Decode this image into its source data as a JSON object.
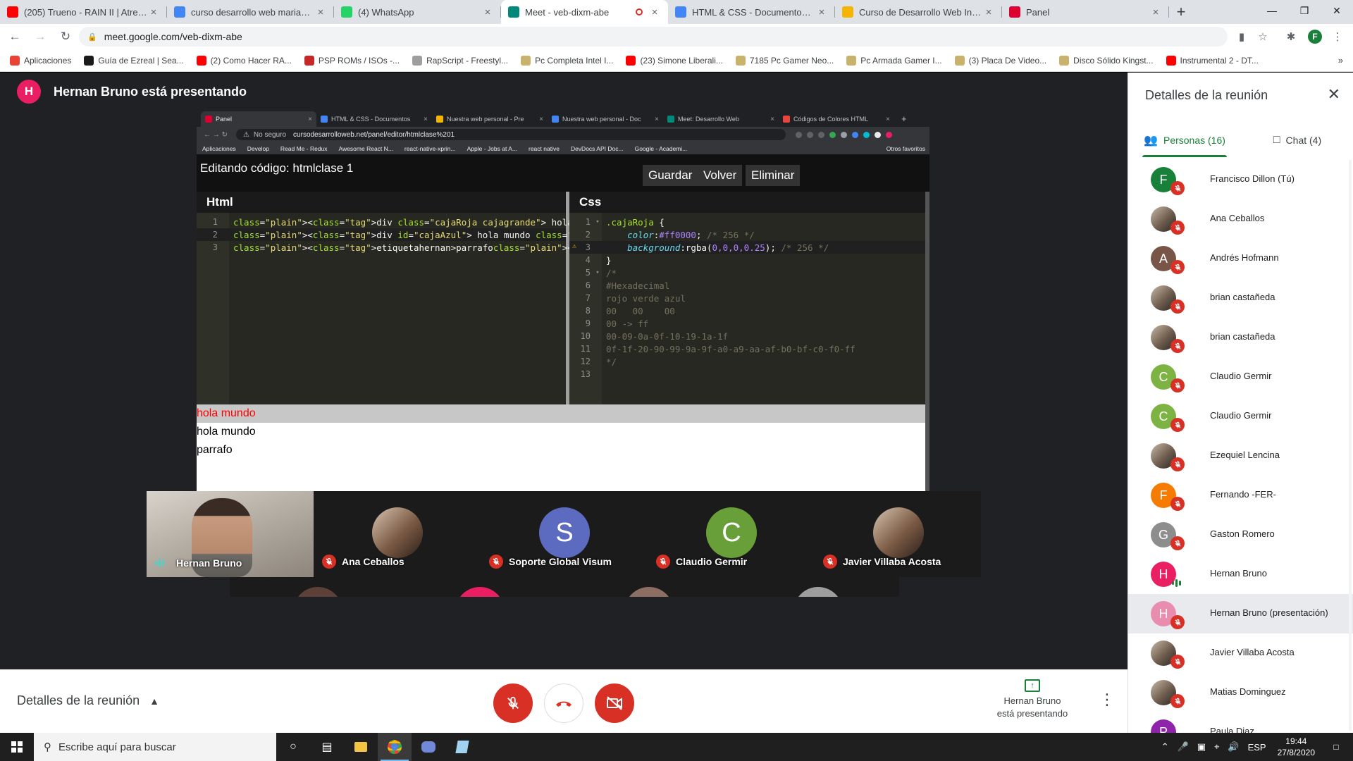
{
  "browser": {
    "tabs": [
      {
        "title": "(205) Trueno - RAIN II | Atrevido",
        "favicon": "youtube",
        "color": "#ff0000"
      },
      {
        "title": "curso desarrollo web mariano mo",
        "favicon": "google",
        "color": "#4285f4"
      },
      {
        "title": "(4) WhatsApp",
        "favicon": "whatsapp",
        "color": "#25d366"
      },
      {
        "title": "Meet - veb-dixm-abe",
        "favicon": "meet",
        "color": "#00897b",
        "active": true,
        "recording": true
      },
      {
        "title": "HTML & CSS - Documentos de G",
        "favicon": "docs",
        "color": "#4285f4"
      },
      {
        "title": "Curso de Desarrollo Web Inicial",
        "favicon": "slides",
        "color": "#f4b400"
      },
      {
        "title": "Panel",
        "favicon": "angular",
        "color": "#dd0031"
      }
    ],
    "url": "meet.google.com/veb-dixm-abe",
    "profile_initial": "F",
    "bookmarks": [
      {
        "label": "Aplicaciones",
        "color": "#ea4335"
      },
      {
        "label": "Guía de Ezreal | Sea...",
        "color": "#1a1a1a"
      },
      {
        "label": "(2) Como Hacer RA...",
        "color": "#ff0000"
      },
      {
        "label": "PSP ROMs / ISOs -...",
        "color": "#c62828"
      },
      {
        "label": "RapScript - Freestyl...",
        "color": "#9e9e9e"
      },
      {
        "label": "Pc Completa Intel I...",
        "color": "#c9b26b"
      },
      {
        "label": "(23) Simone Liberali...",
        "color": "#ff0000"
      },
      {
        "label": "7185 Pc Gamer Neo...",
        "color": "#c9b26b"
      },
      {
        "label": "Pc Armada Gamer I...",
        "color": "#c9b26b"
      },
      {
        "label": "(3) Placa De Video...",
        "color": "#c9b26b"
      },
      {
        "label": "Disco Sólido Kingst...",
        "color": "#c9b26b"
      },
      {
        "label": "Instrumental 2 - DT...",
        "color": "#ff0000"
      }
    ]
  },
  "meet": {
    "presenter_initial": "H",
    "presenter_banner": "Hernan Bruno está presentando",
    "presentation": {
      "tabs": [
        {
          "title": "Panel",
          "color": "#dd0031",
          "active": true
        },
        {
          "title": "HTML & CSS - Documentos",
          "color": "#4285f4"
        },
        {
          "title": "Nuestra web personal - Pre",
          "color": "#f4b400"
        },
        {
          "title": "Nuestra web personal - Doc",
          "color": "#4285f4"
        },
        {
          "title": "Meet: Desarrollo Web",
          "color": "#00897b"
        },
        {
          "title": "Códigos de Colores HTML",
          "color": "#e8453c"
        }
      ],
      "security": "No seguro",
      "url": "cursodesarrolloweb.net/panel/editor/htmlclase%201",
      "bookmarks": [
        "Aplicaciones",
        "Develop",
        "Read Me - Redux",
        "Awesome React N...",
        "react-native-xprin...",
        "Apple - Jobs at A...",
        "react native",
        "DevDocs API Doc...",
        "Google - Academi..."
      ],
      "bookmarks_other": "Otros favoritos",
      "editor_title": "Editando código: htmlclase 1",
      "buttons": {
        "save": "Guardar",
        "back": "Volver",
        "delete": "Eliminar"
      },
      "html_pane_title": "Html",
      "css_pane_title": "Css",
      "html_lines": [
        "<div class=\"cajaRoja cajagrande\"> hola mundo </div>",
        "<div id=\"cajaAzul\"> hola mundo </div>",
        "<etiquetahernan>parrafo</etiquetahernan>"
      ],
      "css_lines": [
        ".cajaRoja {",
        "    color:#ff0000; /* 256 */",
        "    background:rgba(0,0,0,0.25); /* 256 */",
        "}",
        "/*",
        "#Hexadecimal",
        "rojo verde azul",
        "00   00    00",
        "00 -> ff",
        "00-09-0a-0f-10-19-1a-1f",
        "0f-1f-20-90-99-9a-9f-a0-a9-aa-af-b0-bf-c0-f0-ff",
        "*/",
        ""
      ],
      "preview": [
        "hola mundo",
        "hola mundo",
        "parrafo"
      ]
    },
    "strip_tiles": [
      {
        "name": "Hernan Bruno",
        "type": "video",
        "speaking": true
      },
      {
        "name": "Ana Ceballos",
        "type": "photo",
        "muted": true
      },
      {
        "name": "Soporte Global Visum",
        "type": "initial",
        "initial": "S",
        "color": "#5c6bc0",
        "muted": true
      },
      {
        "name": "Claudio Germir",
        "type": "initial",
        "initial": "C",
        "color": "#689f38",
        "muted": true
      },
      {
        "name": "Javier Villaba Acosta",
        "type": "photo",
        "muted": true
      }
    ],
    "controls": {
      "details_label": "Detalles de la reunión",
      "presenting_line1": "Hernan Bruno",
      "presenting_line2": "está presentando"
    },
    "panel": {
      "title": "Detalles de la reunión",
      "tab_people": "Personas (16)",
      "tab_chat": "Chat (4)",
      "people": [
        {
          "name": "Francisco Dillon (Tú)",
          "initial": "F",
          "color": "#188038",
          "muted": true
        },
        {
          "name": "Ana Ceballos",
          "photo": true,
          "muted": true
        },
        {
          "name": "Andrés Hofmann",
          "initial": "A",
          "color": "#795548",
          "muted": true
        },
        {
          "name": "brian castañeda",
          "photo": true,
          "muted": true
        },
        {
          "name": "brian castañeda",
          "photo": true,
          "muted": true
        },
        {
          "name": "Claudio Germir",
          "initial": "C",
          "color": "#7cb342",
          "muted": true
        },
        {
          "name": "Claudio Germir",
          "initial": "C",
          "color": "#7cb342",
          "muted": true
        },
        {
          "name": "Ezequiel Lencina",
          "photo": true,
          "muted": true
        },
        {
          "name": "Fernando -FER-",
          "initial": "F",
          "color": "#f57c00",
          "muted": true
        },
        {
          "name": "Gaston Romero",
          "initial": "G",
          "color": "#8d8d8d",
          "muted": true
        },
        {
          "name": "Hernan Bruno",
          "initial": "H",
          "color": "#e91e63",
          "speaking": true
        },
        {
          "name": "Hernan Bruno (presentación)",
          "initial": "H",
          "color": "#e91e63",
          "muted": true,
          "highlight": true
        },
        {
          "name": "Javier Villaba Acosta",
          "photo": true,
          "muted": true
        },
        {
          "name": "Matias Dominguez",
          "photo": true,
          "muted": true
        },
        {
          "name": "Paula Diaz",
          "initial": "P",
          "color": "#8e24aa",
          "muted": true
        }
      ]
    }
  },
  "taskbar": {
    "search_placeholder": "Escribe aquí para buscar",
    "language": "ESP",
    "time": "19:44",
    "date": "27/8/2020"
  }
}
